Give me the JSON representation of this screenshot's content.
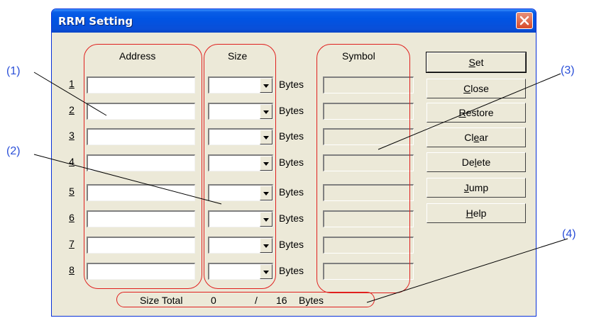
{
  "window": {
    "title": "RRM Setting"
  },
  "headers": {
    "address": "Address",
    "size": "Size",
    "symbol": "Symbol"
  },
  "rows": [
    {
      "num": "1",
      "bytes": "Bytes"
    },
    {
      "num": "2",
      "bytes": "Bytes"
    },
    {
      "num": "3",
      "bytes": "Bytes"
    },
    {
      "num": "4",
      "bytes": "Bytes"
    },
    {
      "num": "5",
      "bytes": "Bytes"
    },
    {
      "num": "6",
      "bytes": "Bytes"
    },
    {
      "num": "7",
      "bytes": "Bytes"
    },
    {
      "num": "8",
      "bytes": "Bytes"
    }
  ],
  "buttons": [
    {
      "label": "Set",
      "key": "set"
    },
    {
      "label": "Close",
      "key": "close"
    },
    {
      "label": "Restore",
      "key": "restore"
    },
    {
      "label": "Clear",
      "key": "clear"
    },
    {
      "label": "Delete",
      "key": "delete"
    },
    {
      "label": "Jump",
      "key": "jump"
    },
    {
      "label": "Help",
      "key": "help"
    }
  ],
  "total": {
    "label": "Size Total",
    "used": "0",
    "sep": "/",
    "max": "16",
    "unit": "Bytes"
  },
  "callouts": [
    "(1)",
    "(2)",
    "(3)",
    "(4)"
  ],
  "colors": {
    "accent": "#0054e3",
    "annotation": "#e0201e",
    "callout_text": "#2a4fd8"
  }
}
